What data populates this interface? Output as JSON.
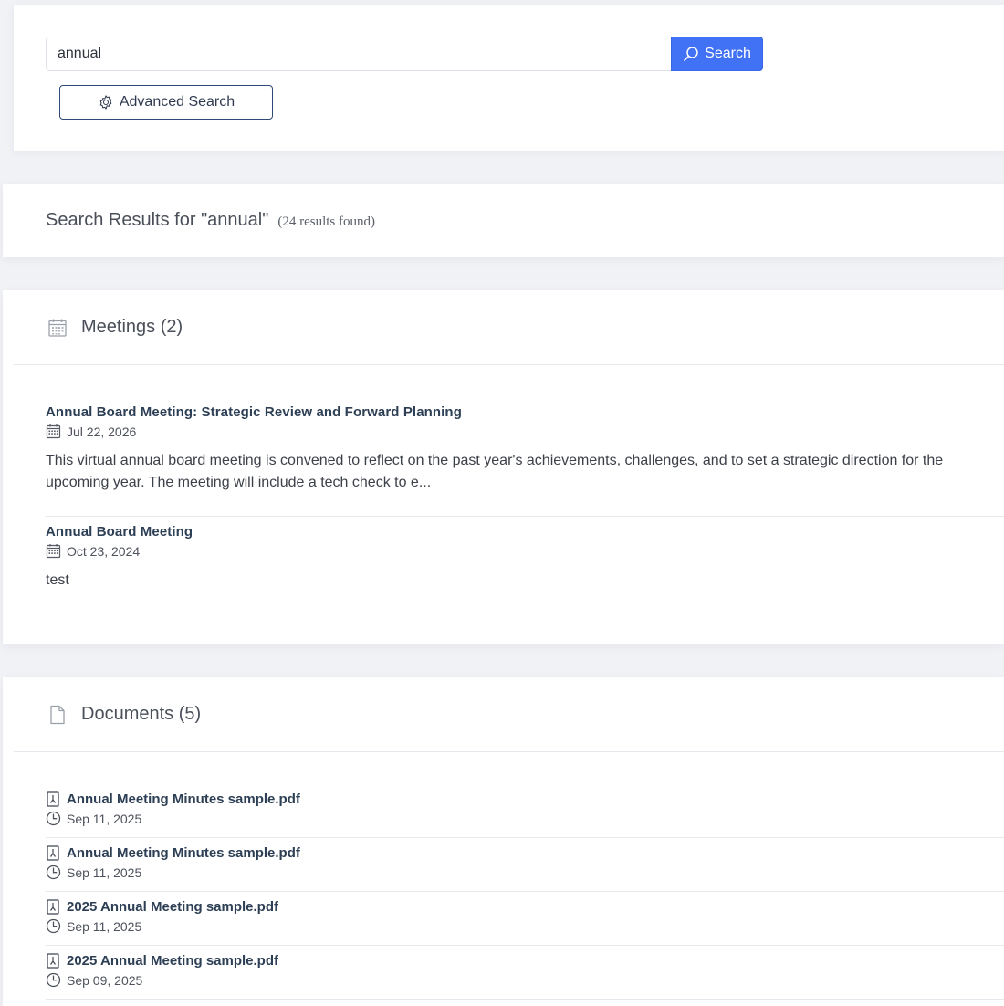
{
  "search": {
    "value": "annual",
    "button_label": "Search",
    "advanced_label": "Advanced Search"
  },
  "results": {
    "heading": "Search Results for \"annual\"",
    "count_text": "(24 results found)"
  },
  "meetings": {
    "title": "Meetings (2)",
    "items": [
      {
        "title": "Annual Board Meeting: Strategic Review and Forward Planning",
        "date": "Jul 22, 2026",
        "description": "This virtual annual board meeting is convened to reflect on the past year's achievements, challenges, and to set a strategic direction for the upcoming year. The meeting will include a tech check to e..."
      },
      {
        "title": "Annual Board Meeting",
        "date": "Oct 23, 2024",
        "description": "test"
      }
    ]
  },
  "documents": {
    "title": "Documents (5)",
    "items": [
      {
        "title": "Annual Meeting Minutes sample.pdf",
        "date": "Sep 11, 2025"
      },
      {
        "title": "Annual Meeting Minutes sample.pdf",
        "date": "Sep 11, 2025"
      },
      {
        "title": "2025 Annual Meeting sample.pdf",
        "date": "Sep 11, 2025"
      },
      {
        "title": "2025 Annual Meeting sample.pdf",
        "date": "Sep 09, 2025"
      }
    ]
  },
  "icons": {
    "search_button": "search-icon",
    "advanced_button": "gear-icon",
    "meetings_header": "calendar-icon",
    "documents_header": "document-icon",
    "meeting_date": "calendar-icon",
    "document_file": "pdf-file-icon",
    "document_date": "clock-icon"
  },
  "colors": {
    "primary": "#4171f5",
    "title_text": "#2d3f55",
    "outline_button": "#2e4a78",
    "background": "#f1f2f6"
  }
}
